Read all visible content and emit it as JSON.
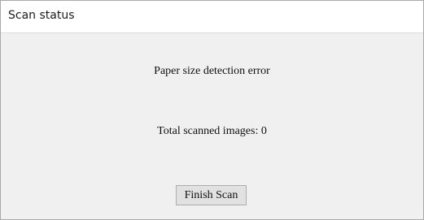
{
  "window": {
    "title": "Scan status"
  },
  "status": {
    "error_message": "Paper size detection error",
    "scanned_count_text": "Total scanned images: 0"
  },
  "actions": {
    "finish_label": "Finish Scan"
  },
  "colors": {
    "titlebar_bg": "#ffffff",
    "body_bg": "#f0f0f0",
    "button_bg": "#e1e1e1",
    "button_border": "#adadad"
  }
}
